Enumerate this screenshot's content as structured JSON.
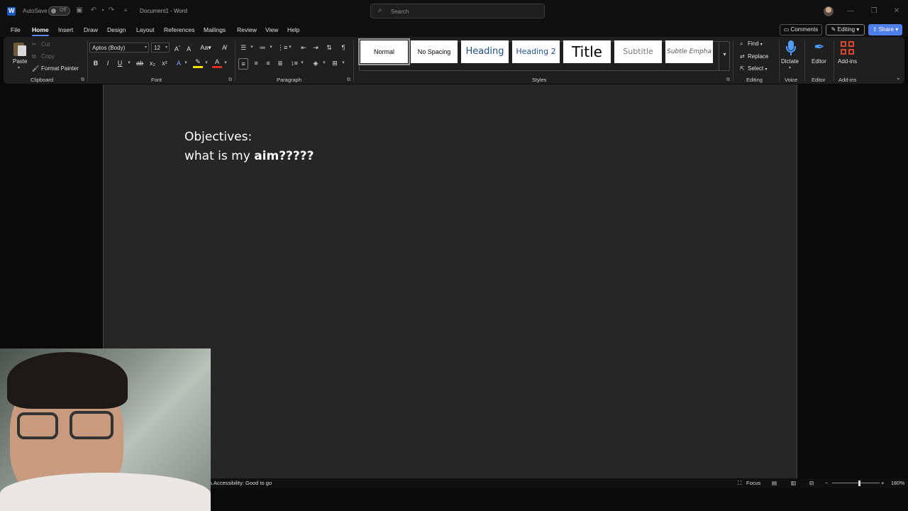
{
  "titlebar": {
    "autosave_label": "AutoSave",
    "autosave_state": "Off",
    "doc_title": "Document1  -  Word",
    "search_placeholder": "Search"
  },
  "tabs": [
    "File",
    "Home",
    "Insert",
    "Draw",
    "Design",
    "Layout",
    "References",
    "Mailings",
    "Review",
    "View",
    "Help"
  ],
  "active_tab": "Home",
  "header_buttons": {
    "comments": "Comments",
    "editing": "Editing",
    "share": "Share"
  },
  "ribbon": {
    "clipboard": {
      "paste": "Paste",
      "cut": "Cut",
      "copy": "Copy",
      "format_painter": "Format Painter",
      "label": "Clipboard"
    },
    "font": {
      "family": "Aptos (Body)",
      "size": "12",
      "label": "Font"
    },
    "paragraph": {
      "label": "Paragraph"
    },
    "styles": {
      "label": "Styles",
      "items": [
        "Normal",
        "No Spacing",
        "Heading",
        "Heading 2",
        "Title",
        "Subtitle",
        "Subtle Empha"
      ]
    },
    "editing": {
      "find": "Find",
      "replace": "Replace",
      "select": "Select",
      "label": "Editing"
    },
    "voice": {
      "dictate": "Dictate",
      "label": "Voice"
    },
    "editor": {
      "editor": "Editor",
      "label": "Editor"
    },
    "addins": {
      "addins": "Add-ins",
      "label": "Add-ins"
    }
  },
  "document": {
    "line1": "Objectives:",
    "line2_plain": "what is my ",
    "line2_bold": "aim?????"
  },
  "statusbar": {
    "accessibility": "Accessibility: Good to go",
    "focus": "Focus",
    "zoom": "180%"
  },
  "colors": {
    "accent": "#4f7fe8",
    "page": "#262626",
    "ribbon": "#1f1f1f"
  }
}
